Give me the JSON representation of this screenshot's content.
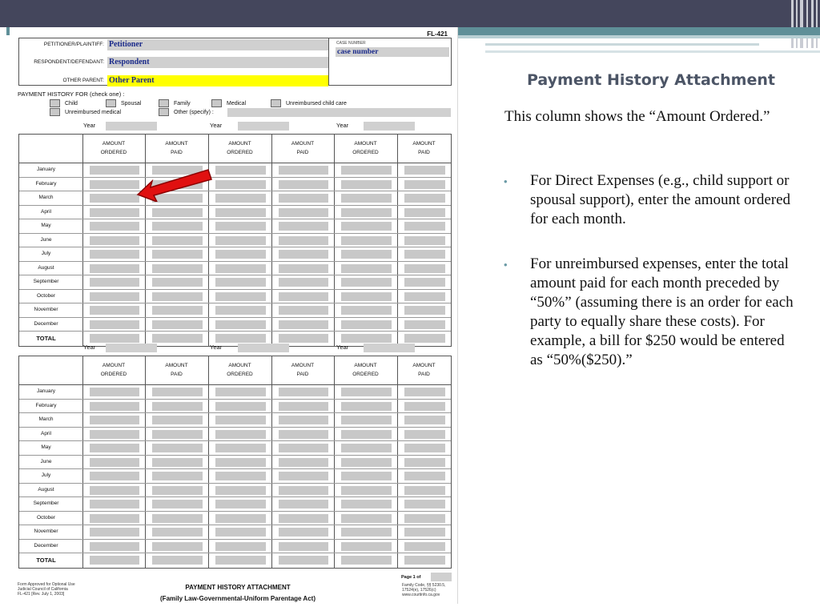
{
  "slide": {
    "title": "Payment History Attachment",
    "intro": "This column shows the “Amount Ordered.”",
    "bullets": [
      "For Direct Expenses (e.g., child support or spousal support), enter the amount ordered for each month.",
      "For unreimbursed expenses, enter the total amount paid for each month preceded by “50%” (assuming there is an order for each party to equally share these costs). For example, a bill for $250 would be entered as “50%($250).”"
    ],
    "bullet_symbol": "•",
    "colors": {
      "topbar": "#44465c",
      "accent_teal": "#5f8f98",
      "title": "#4c5566",
      "arrow": "#e01010",
      "highlight_yellow": "#ffff00"
    }
  },
  "form": {
    "form_number": "FL-421",
    "header": {
      "petitioner_label": "PETITIONER/PLAINTIFF:",
      "petitioner_value": "Petitioner",
      "respondent_label": "RESPONDENT/DEFENDANT:",
      "respondent_value": "Respondent",
      "other_parent_label": "OTHER PARENT:",
      "other_parent_value": "Other Parent",
      "case_number_label": "CASE NUMBER",
      "case_number_value": "case number"
    },
    "payment_history_for": "PAYMENT HISTORY FOR (check one) :",
    "checkboxes": [
      "Child",
      "Spousal",
      "Family",
      "Medical",
      "Unreimbursed child care",
      "Unreimbursed medical",
      "Other (specify) :"
    ],
    "year_label": "Year",
    "column_headers": [
      [
        "AMOUNT",
        "ORDERED"
      ],
      [
        "AMOUNT",
        "PAID"
      ],
      [
        "AMOUNT",
        "ORDERED"
      ],
      [
        "AMOUNT",
        "PAID"
      ],
      [
        "AMOUNT",
        "ORDERED"
      ],
      [
        "AMOUNT",
        "PAID"
      ]
    ],
    "months": [
      "January",
      "February",
      "March",
      "April",
      "May",
      "June",
      "July",
      "August",
      "September",
      "October",
      "November",
      "December",
      "TOTAL"
    ],
    "footer": {
      "left": [
        "Form Approved for Optional Use",
        "Judicial Council of California",
        "FL-421 [Rev. July 1, 2003]"
      ],
      "title": "PAYMENT HISTORY ATTACHMENT",
      "subtitle": "(Family Law-Governmental-Uniform Parentage Act)",
      "right": [
        "Family Code, §§ 5230.5,",
        "17524(e), 17526(c)",
        "www.courtinfo.ca.gov"
      ],
      "page": "Page 1 of"
    }
  }
}
